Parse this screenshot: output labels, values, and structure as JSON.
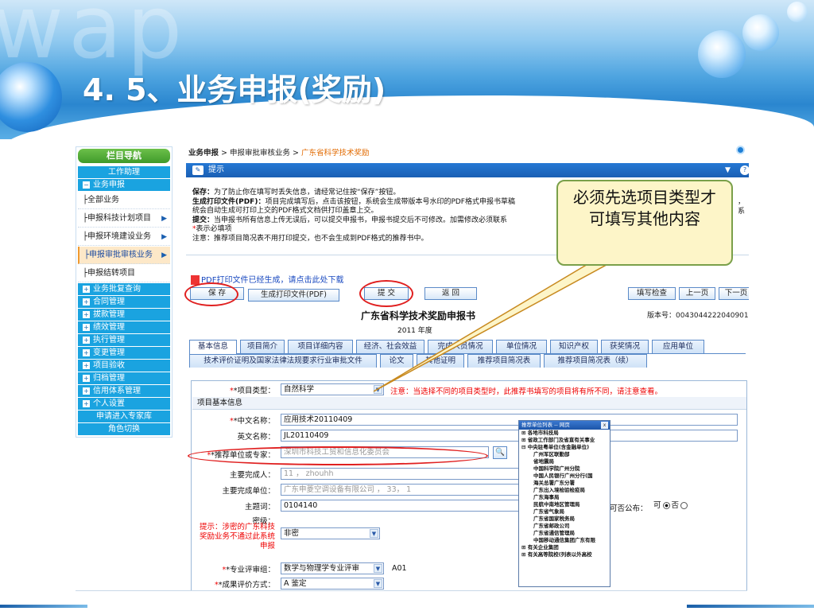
{
  "slide": {
    "watermark": "wap",
    "title": "4. 5、业务申报(奖励)"
  },
  "sidebar": {
    "header": "栏目导航",
    "items": [
      {
        "label": "工作助理",
        "kind": "blue-center"
      },
      {
        "label": "业务申报",
        "kind": "blue-minus"
      },
      {
        "label": "├全部业务",
        "kind": "sub"
      },
      {
        "label": "├申报科技计划项目",
        "kind": "sub-arrow"
      },
      {
        "label": "├申报环境建设业务",
        "kind": "sub-arrow"
      },
      {
        "label": "├申报审批审核业务",
        "kind": "sub-arrow-active"
      },
      {
        "label": "├申报结转项目",
        "kind": "sub"
      },
      {
        "label": "业务批复查询",
        "kind": "blue-plus"
      },
      {
        "label": "合同管理",
        "kind": "blue-plus"
      },
      {
        "label": "拔款管理",
        "kind": "blue-plus"
      },
      {
        "label": "绩效管理",
        "kind": "blue-plus"
      },
      {
        "label": "执行管理",
        "kind": "blue-plus"
      },
      {
        "label": "变更管理",
        "kind": "blue-plus"
      },
      {
        "label": "项目验收",
        "kind": "blue-plus"
      },
      {
        "label": "归档管理",
        "kind": "blue-plus"
      },
      {
        "label": "信用体系管理",
        "kind": "blue-plus"
      },
      {
        "label": "个人设置",
        "kind": "blue-plus"
      },
      {
        "label": "申请进入专家库",
        "kind": "blue-center"
      },
      {
        "label": "角色切换",
        "kind": "blue-center"
      }
    ],
    "plus_glyph": "+",
    "minus_glyph": "−",
    "arrow_glyph": "▶"
  },
  "breadcrumb": {
    "part1": "业务申报",
    "sep": " > ",
    "part2": "申报审批审核业务",
    "part3": "广东省科学技术奖励"
  },
  "tip": {
    "title": "提示",
    "collapse": "▼",
    "help": "?",
    "lines": [
      {
        "head": "保存：",
        "text": "为了防止你在填写时丢失信息，请经常记住按“保存”按钮。"
      },
      {
        "head": "生成打印文件(PDF)：",
        "text": "项目完成填写后，点击该按钮，系统会生成带版本号水印的PDF格式申报书草稿"
      },
      {
        "head": "",
        "text": "统会自动生成可打印上交的PDF格式文档供打印盖章上交。"
      },
      {
        "head": "提交：",
        "text": "当申报书所有信息上传无误后，可以提交申报书，申报书提交后不可修改。加需修改必须联系"
      },
      {
        "head": "",
        "text": "表示必填项",
        "star": "*"
      },
      {
        "head": "",
        "text": "注意：推荐项目简况表不用打印提交，也不会生成到PDF格式的推荐书中。"
      }
    ],
    "right_fragment": "，系"
  },
  "pdf_notice": "PDF打印文件已经生成，请点击此处下载",
  "toolbar": {
    "save": "保 存",
    "gen_pdf": "生成打印文件(PDF)",
    "submit": "提 交",
    "back": "返 回",
    "check": "填写检查",
    "prev": "上一页",
    "next": "下一页"
  },
  "form": {
    "title": "广东省科学技术奖励申报书",
    "year": "2011 年度",
    "version_label": "版本号：",
    "version_value": "0043044222040901"
  },
  "tabs_row1": [
    "基本信息",
    "项目简介",
    "项目详细内容",
    "经济、社会效益",
    "完成人员情况",
    "单位情况",
    "知识产权",
    "获奖情况",
    "应用单位"
  ],
  "tabs_row2": [
    "技术评价证明及国家法律法规要求行业审批文件",
    "论文",
    "其他证明",
    "推荐项目简况表",
    "推荐项目简况表（续）"
  ],
  "fields": {
    "project_type_label": "*项目类型：",
    "project_type_value": "自然科学",
    "project_type_note": "注意：当选择不同的项目类型时，此推荐书填写的项目将有所不同，请注意查看。",
    "section": "项目基本信息",
    "cn_name_label": "*中文名称：",
    "cn_name_value": "应用技术20110409",
    "en_name_label": "英文名称：",
    "en_name_value": "JL20110409",
    "recommender_label": "*推荐单位或专家：",
    "recommender_value": "深圳市科技工贸和信息化委员会",
    "main_person_label": "主要完成人：",
    "main_person_value": "11 ，  zhouhh",
    "main_unit_label": "主要完成单位：",
    "main_unit_value": "广东申菱空调设备有限公司 ，  33，  1",
    "keyword_label": "主题词：",
    "keyword_value": "0104140",
    "secret_label": "密级：",
    "secret_note": "提示：涉密的广东科技奖励业务不通过此系统申报",
    "secret_value": "非密",
    "publish_label": "可否公布：",
    "publish_yes": "可",
    "publish_no": "否",
    "review_label": "*专业评审组：",
    "review_value": "数学与物理学专业评审",
    "review_code": "A01",
    "eval_label": "*成果评价方式：",
    "eval_value": "A 鉴定"
  },
  "popup": {
    "title": "推荐单位列表 -- 网页",
    "close": "x",
    "items": [
      {
        "text": "⊞ 各地市科技局",
        "level": 1
      },
      {
        "text": "⊞ 省政工作部门及省直有关事业",
        "level": 1
      },
      {
        "text": "⊟ 中央驻粤单位(含金融单位)",
        "level": 1
      },
      {
        "text": "广州军区联勤部",
        "level": 2
      },
      {
        "text": "省地震局",
        "level": 2
      },
      {
        "text": "中国科学院广州分院",
        "level": 2
      },
      {
        "text": "中国人民银行广州分行(国",
        "level": 2
      },
      {
        "text": "海关总署广东分署",
        "level": 2
      },
      {
        "text": "广东出入境检验检疫局",
        "level": 2
      },
      {
        "text": "广东海事局",
        "level": 2
      },
      {
        "text": "民航中南地区管理局",
        "level": 2
      },
      {
        "text": "广东省气象局",
        "level": 2
      },
      {
        "text": "广东省国家税务局",
        "level": 2
      },
      {
        "text": "广东省邮政公司",
        "level": 2
      },
      {
        "text": "广东省通信管理局",
        "level": 2
      },
      {
        "text": "中国移动通信集团广东有限",
        "level": 2
      },
      {
        "text": "⊞ 有关企业集团",
        "level": 1
      },
      {
        "text": "⊞ 有关高等院校(列表以外高校",
        "level": 1
      }
    ]
  },
  "callout": "必须先选项目类型才可填写其他内容",
  "colors": {
    "accent": "#1aa3e0",
    "banner": "#2a86cf",
    "annotation_red": "#e02020",
    "callout_bg": "#fdf5c8"
  }
}
